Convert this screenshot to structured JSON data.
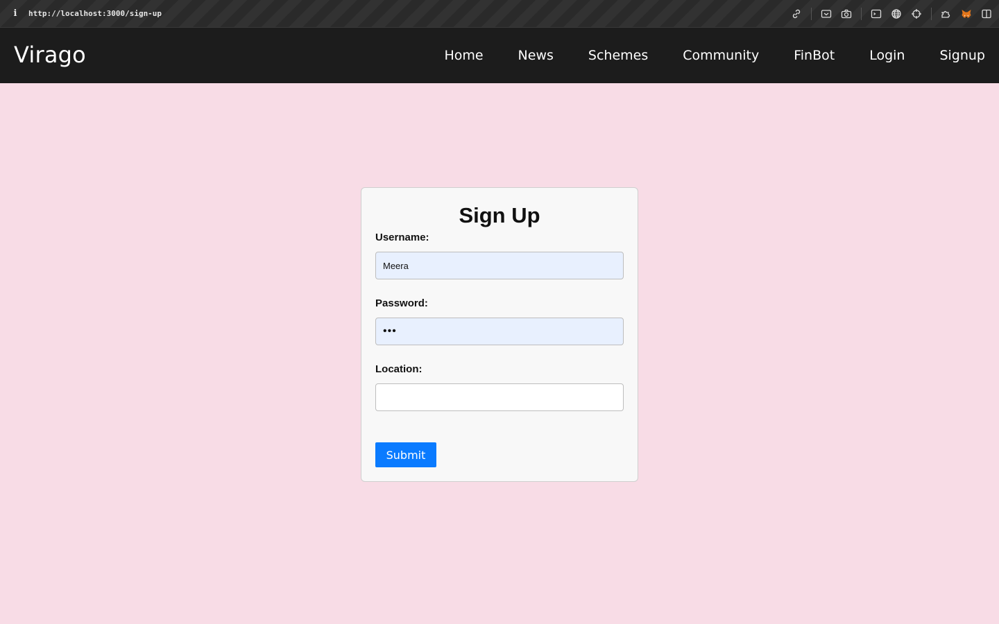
{
  "browser": {
    "url": "http://localhost:3000/sign-up",
    "info_glyph": "i",
    "toolbar_icons": [
      "link-icon",
      "screencast-icon",
      "camera-icon",
      "terminal-icon",
      "globe-icon",
      "crosshair-icon",
      "extensions-icon",
      "metamask-fox-icon",
      "sidebar-icon"
    ]
  },
  "navbar": {
    "brand": "Virago",
    "links": [
      "Home",
      "News",
      "Schemes",
      "Community",
      "FinBot",
      "Login",
      "Signup"
    ]
  },
  "form": {
    "title": "Sign Up",
    "username_label": "Username:",
    "username_value": "Meera",
    "password_label": "Password:",
    "password_value": "•••",
    "location_label": "Location:",
    "location_value": "",
    "submit_label": "Submit"
  },
  "colors": {
    "page_background": "#f8dce6",
    "navbar_background": "#1c1c1c",
    "submit_button": "#0a7bff",
    "autofill_background": "#e8f0fe"
  }
}
